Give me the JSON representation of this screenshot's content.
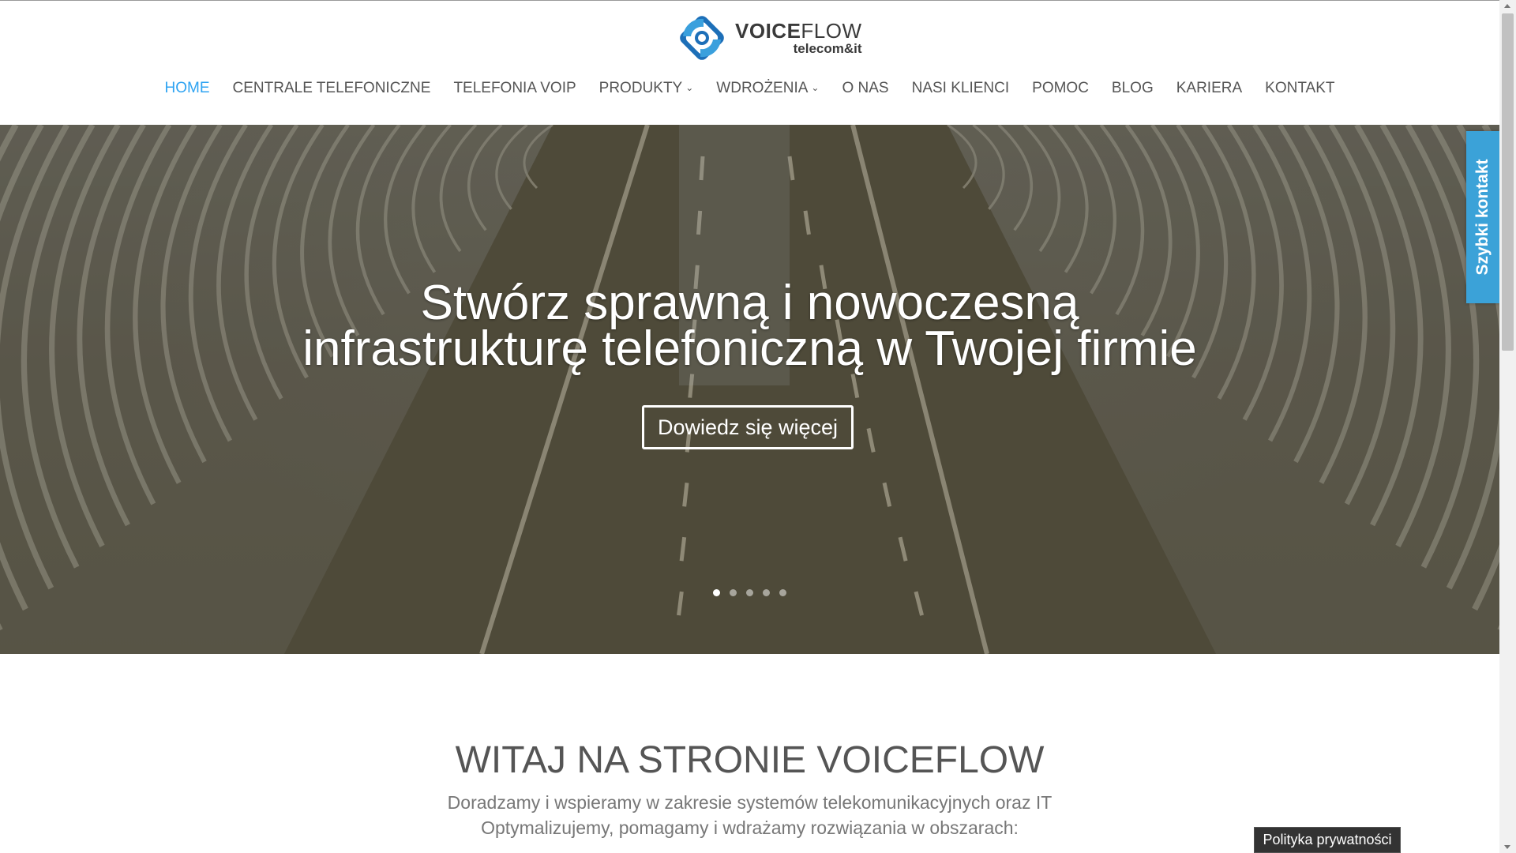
{
  "brand": {
    "name_bold": "VOICE",
    "name_light": "FLOW",
    "sub": "telecom&it"
  },
  "nav": [
    {
      "label": "HOME",
      "active": true,
      "dropdown": false
    },
    {
      "label": "CENTRALE TELEFONICZNE",
      "active": false,
      "dropdown": false
    },
    {
      "label": "TELEFONIA VOIP",
      "active": false,
      "dropdown": false
    },
    {
      "label": "PRODUKTY",
      "active": false,
      "dropdown": true
    },
    {
      "label": "WDROŻENIA",
      "active": false,
      "dropdown": true
    },
    {
      "label": "O NAS",
      "active": false,
      "dropdown": false
    },
    {
      "label": "NASI KLIENCI",
      "active": false,
      "dropdown": false
    },
    {
      "label": "POMOC",
      "active": false,
      "dropdown": false
    },
    {
      "label": "BLOG",
      "active": false,
      "dropdown": false
    },
    {
      "label": "KARIERA",
      "active": false,
      "dropdown": false
    },
    {
      "label": "KONTAKT",
      "active": false,
      "dropdown": false
    }
  ],
  "hero": {
    "title_line1": "Stwórz sprawną i nowoczesną",
    "title_line2": "infrastrukturę telefoniczną w Twojej firmie",
    "button": "Dowiedz się więcej",
    "slides": 5,
    "active_slide": 1
  },
  "quick_contact": "Szybki kontakt",
  "welcome": {
    "title": "WITAJ NA STRONIE VOICEFLOW",
    "line1": "Doradzamy i wspieramy w zakresie systemów telekomunikacyjnych oraz IT",
    "line2": "Optymalizujemy, pomagamy i wdrażamy rozwiązania w obszarach:"
  },
  "privacy": "Polityka prywatności",
  "colors": {
    "accent": "#2ea3f2",
    "quick_contact": "#3ba2d8"
  }
}
